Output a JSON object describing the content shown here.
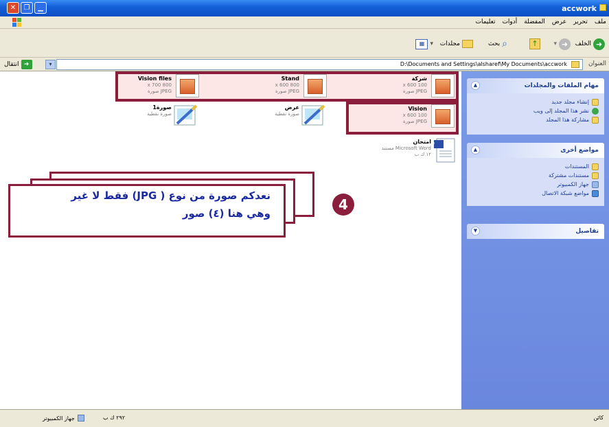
{
  "window": {
    "title": "accwork",
    "controls": {
      "close": "✕",
      "maximize": "❐",
      "minimize": "▁"
    }
  },
  "menu": [
    "ملف",
    "تحرير",
    "عرض",
    "المفضلة",
    "أدوات",
    "تعليمات"
  ],
  "toolbar": {
    "back": "الخلف",
    "search": "بحث",
    "folders": "مجلدات",
    "views_icon": "views-grid-icon"
  },
  "address": {
    "label": "العنوان",
    "path": "D:\\Documents and Settings\\alsharef\\My Documents\\accwork",
    "go": "انتقال"
  },
  "sidepane": {
    "panels": [
      {
        "title": "مهام الملفات والمجلدات",
        "items": [
          "إنشاء مجلد جديد",
          "نشر هذا المجلد إلى ويب",
          "مشاركة هذا المجلد"
        ]
      },
      {
        "title": "مواضع أخرى",
        "items": [
          "المستندات",
          "مستندات مشتركة",
          "جهاز الكمبيوتر",
          "مواضع شبكة الاتصال"
        ]
      },
      {
        "title": "تفاصيل",
        "items": []
      }
    ]
  },
  "files": [
    {
      "name": "شركة",
      "dims": "100 x 600",
      "type": "JPEG صورة",
      "kind": "jpg"
    },
    {
      "name": "Stand",
      "dims": "800 x 600",
      "type": "JPEG صورة",
      "kind": "jpg"
    },
    {
      "name": "Vision files",
      "dims": "800 x 700",
      "type": "JPEG صورة",
      "kind": "jpg"
    },
    {
      "name": "Vision",
      "dims": "100 x 600",
      "type": "JPEG صورة",
      "kind": "jpg"
    },
    {
      "name": "عرض",
      "dims": "",
      "type": "صورة نقطية",
      "kind": "bmp"
    },
    {
      "name": "صورة1",
      "dims": "",
      "type": "صورة نقطية",
      "kind": "bmp"
    },
    {
      "name": "امتحان",
      "dims": "",
      "type": "Microsoft Word مستند",
      "extra": "١٢ ك ب",
      "kind": "doc"
    }
  ],
  "callout": {
    "number": "4",
    "line1": "نعدكم صورة من نوع ( JPG) فقط لا غير",
    "line2": "وهي هنا (٤) صور"
  },
  "status": {
    "left_label": "جهاز الكمبيوتر",
    "size": "٢٩٢ ك ب",
    "right": "كائن"
  },
  "colors": {
    "highlight": "#8a1e3c",
    "callout_text": "#1a2aa0",
    "sidepane": "#6a87de"
  }
}
